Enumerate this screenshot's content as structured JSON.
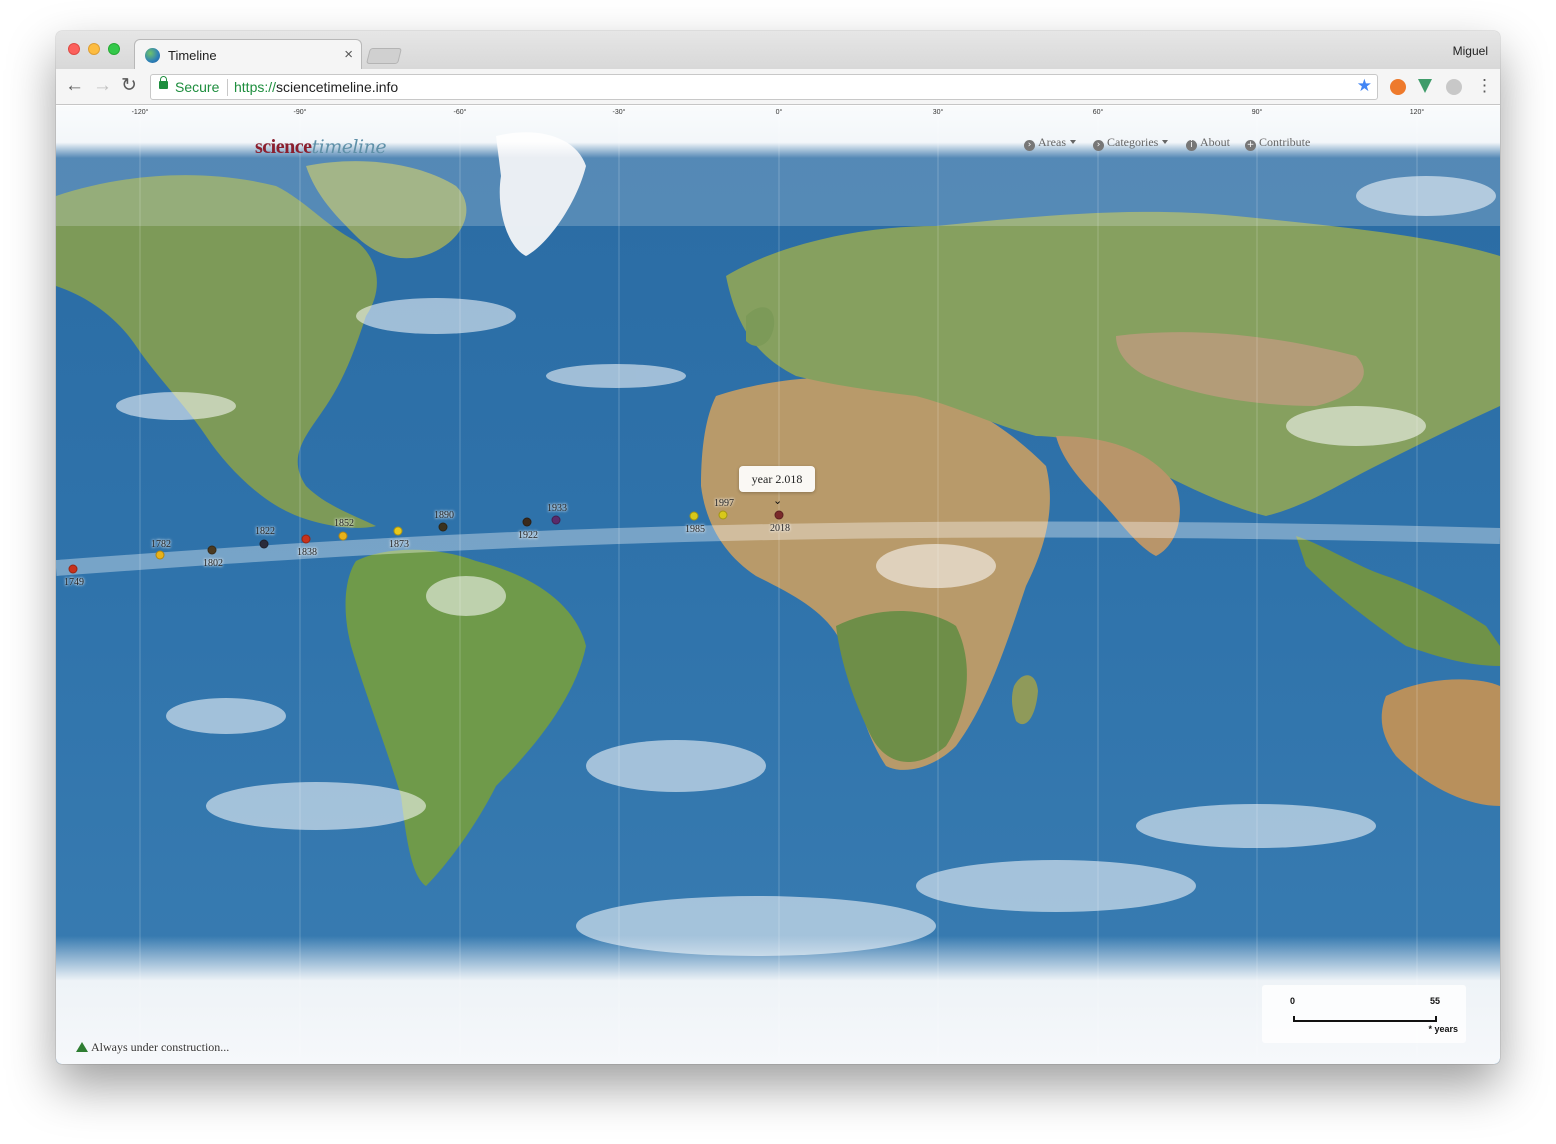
{
  "browser": {
    "tab_title": "Timeline",
    "close_glyph": "×",
    "profile_name": "Miguel",
    "secure_label": "Secure",
    "url_scheme": "https://",
    "url_host": "sciencetimeline.info",
    "back_glyph": "←",
    "forward_glyph": "→",
    "reload_glyph": "↻",
    "bookmark_glyph": "★",
    "menu_glyph": "⋮"
  },
  "header": {
    "logo_science": "science",
    "logo_timeline": "timeline",
    "longitudes": [
      "-120°",
      "-90°",
      "-60°",
      "-30°",
      "0°",
      "30°",
      "60°",
      "90°",
      "120°"
    ],
    "menu": [
      {
        "label": "Areas",
        "icon": "chevron-circle-icon"
      },
      {
        "label": "Categories",
        "icon": "chevron-circle-icon"
      },
      {
        "label": "About",
        "icon": "info-circle-icon"
      },
      {
        "label": "Contribute",
        "icon": "plus-circle-icon"
      }
    ]
  },
  "timeline": {
    "tooltip": "year 2.018",
    "events": [
      {
        "year": "1749",
        "color": "#c8321c"
      },
      {
        "year": "1782",
        "color": "#e8b21a"
      },
      {
        "year": "1802",
        "color": "#4a3a22"
      },
      {
        "year": "1822",
        "color": "#2b2b3a"
      },
      {
        "year": "1838",
        "color": "#c8321c"
      },
      {
        "year": "1852",
        "color": "#e8b21a"
      },
      {
        "year": "1873",
        "color": "#e8c81a"
      },
      {
        "year": "1890",
        "color": "#3a3320"
      },
      {
        "year": "1922",
        "color": "#3a2a1c"
      },
      {
        "year": "1933",
        "color": "#5a2a6a"
      },
      {
        "year": "1985",
        "color": "#d8c81a"
      },
      {
        "year": "1997",
        "color": "#d8c81a"
      },
      {
        "year": "2018",
        "color": "#7a2a2a"
      }
    ]
  },
  "legend": {
    "min": "0",
    "max": "55",
    "units": "* years"
  },
  "footer": {
    "construction": "Always under construction..."
  },
  "colors": {
    "ocean": "#2f6fa3",
    "logo_science": "#8b1f2e",
    "logo_timeline": "#5f90a8",
    "secure_green": "#1e8e3e"
  }
}
